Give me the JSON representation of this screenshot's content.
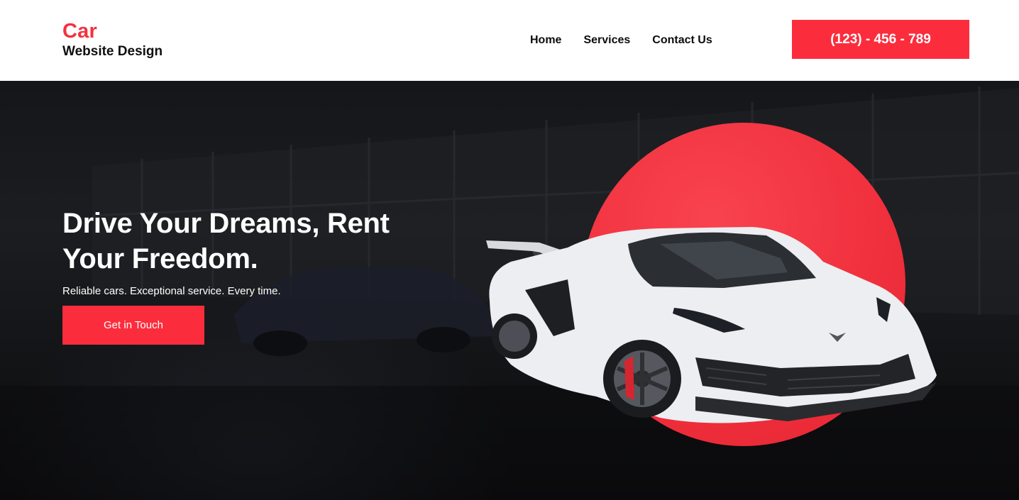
{
  "brand": {
    "name": "Car",
    "tagline": "Website Design"
  },
  "nav": {
    "items": [
      "Home",
      "Services",
      "Contact Us"
    ]
  },
  "phone": {
    "label": "(123) - 456 - 789"
  },
  "hero": {
    "title": "Drive Your Dreams, Rent Your Freedom.",
    "subtitle": "Reliable cars. Exceptional service. Every time.",
    "cta_label": "Get in Touch"
  },
  "colors": {
    "accent": "#fb2d3d",
    "text_dark": "#0d0d0d",
    "hero_bg": "#151619"
  },
  "icons": {
    "hero_image": "sports-car-illustration"
  }
}
